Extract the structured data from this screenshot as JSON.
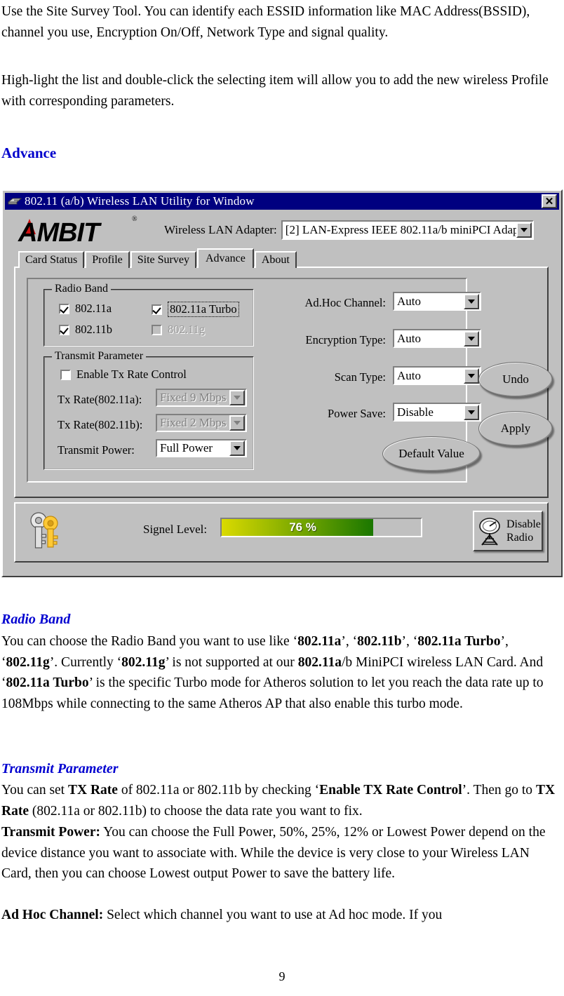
{
  "document": {
    "intro_paragraphs": [
      "Use the Site Survey Tool. You can identify each ESSID information like MAC Address(BSSID), channel you use, Encryption On/Off, Network Type and signal quality.",
      "High-light the list and double-click the selecting item will allow you to add the new wireless Profile with corresponding parameters."
    ],
    "section_heading": "Advance",
    "radio_band_heading": "Radio Band",
    "radio_band_body_1": "You can choose the Radio Band you want to use like ‘",
    "radio_band_body": "You can choose the Radio Band you want to use like ‘802.11a’, ‘802.11b’, ‘802.11a Turbo’, ‘802.11g’. Currently ‘802.11g’ is not supported at our 802.11a/b MiniPCI wireless LAN Card. And ‘802.11a Turbo’ is the specific Turbo mode for Atheros solution to let you reach the data rate up to 108Mbps while connecting to the same Atheros AP that also enable this turbo mode.",
    "transmit_parameter_heading": "Transmit Parameter",
    "transmit_parameter_body": "You can set TX Rate of 802.11a or 802.11b by checking ‘Enable TX Rate Control’. Then go to TX Rate (802.11a or 802.11b) to choose the data rate you want to fix.",
    "transmit_power_body": "Transmit Power: You can choose the Full Power, 50%, 25%, 12% or Lowest Power depend on the device distance you want to associate with. While the device is very close to your Wireless LAN Card, then you can choose Lowest output Power to save the battery life.",
    "ad_hoc_channel_body": "Ad Hoc Channel: Select which channel you want to use at Ad hoc mode. If you",
    "page_number": "9"
  },
  "app": {
    "title": "802.11 (a/b) Wireless LAN Utility for Window",
    "close_label": "✕",
    "logo_text": "AMBIT",
    "logo_registered": "®",
    "adapter_label": "Wireless LAN Adapter:",
    "adapter_value": "[2] LAN-Express IEEE 802.11a/b miniPCI Adapter",
    "tabs": [
      {
        "label": "Card Status",
        "active": false
      },
      {
        "label": "Profile",
        "active": false
      },
      {
        "label": "Site Survey",
        "active": false
      },
      {
        "label": "Advance",
        "active": true
      },
      {
        "label": "About",
        "active": false
      }
    ],
    "radio_band": {
      "group_label": "Radio Band",
      "items": [
        {
          "label": "802.11a",
          "checked": true,
          "disabled": false,
          "focused": false
        },
        {
          "label": "802.11a Turbo",
          "checked": true,
          "disabled": false,
          "focused": true
        },
        {
          "label": "802.11b",
          "checked": true,
          "disabled": false,
          "focused": false
        },
        {
          "label": "802.11g",
          "checked": false,
          "disabled": true,
          "focused": false
        }
      ]
    },
    "transmit_parameter": {
      "group_label": "Transmit Parameter",
      "enable_tx_rate_control": {
        "label": "Enable Tx Rate Control",
        "checked": false
      },
      "tx_rate_a": {
        "label": "Tx Rate(802.11a):",
        "value": "Fixed 9 Mbps",
        "disabled": true
      },
      "tx_rate_b": {
        "label": "Tx Rate(802.11b):",
        "value": "Fixed 2 Mbps",
        "disabled": true
      },
      "transmit_power": {
        "label": "Transmit Power:",
        "value": "Full Power",
        "disabled": false
      }
    },
    "right_fields": [
      {
        "label": "Ad.Hoc Channel:",
        "value": "Auto"
      },
      {
        "label": "Encryption Type:",
        "value": "Auto"
      },
      {
        "label": "Scan Type:",
        "value": "Auto"
      },
      {
        "label": "Power Save:",
        "value": "Disable"
      }
    ],
    "buttons": {
      "undo": "Undo",
      "apply": "Apply",
      "default_value": "Default Value"
    },
    "status": {
      "signal_label": "Signel Level:",
      "signal_percent": 76,
      "signal_text": "76 %",
      "disable_radio_line1": "Disable",
      "disable_radio_line2": "Radio"
    },
    "colors": {
      "titlebar": "#000080",
      "face": "#c0c0c0",
      "signal_gradient_start": "#dada00",
      "signal_gradient_end": "#1a7700",
      "heading_blue": "#0000cc",
      "logo_red": "#d01010"
    }
  }
}
